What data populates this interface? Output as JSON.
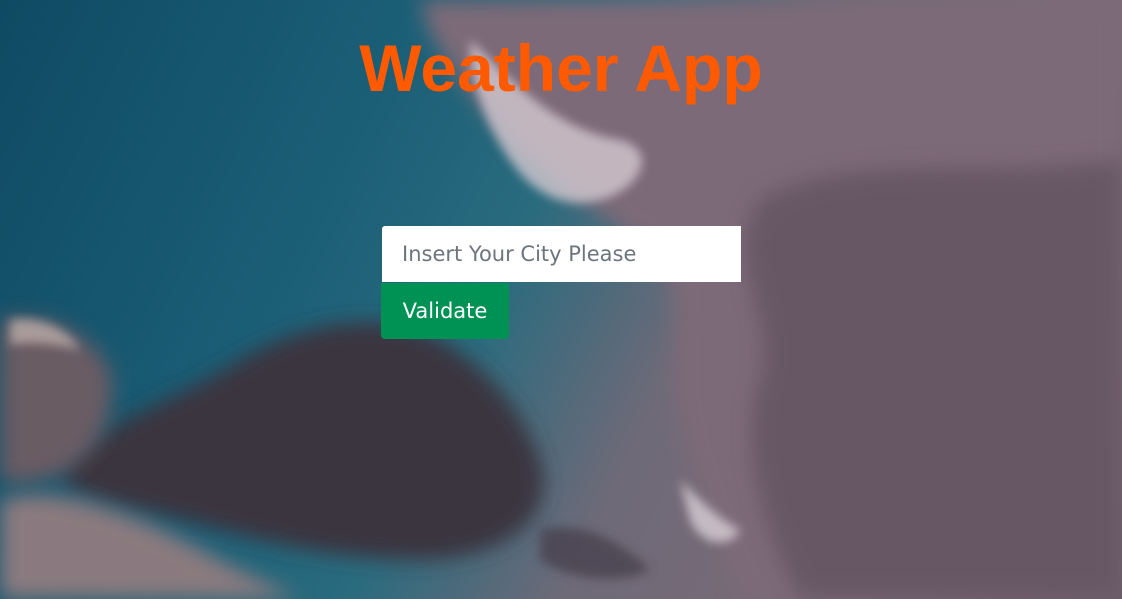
{
  "app": {
    "title": "Weather App"
  },
  "search": {
    "placeholder": "Insert Your City Please",
    "value": ""
  },
  "actions": {
    "validate_label": "Validate"
  },
  "colors": {
    "title": "#ff5a00",
    "button_bg": "#009155",
    "button_text": "#ffffff",
    "input_bg": "#ffffff"
  }
}
